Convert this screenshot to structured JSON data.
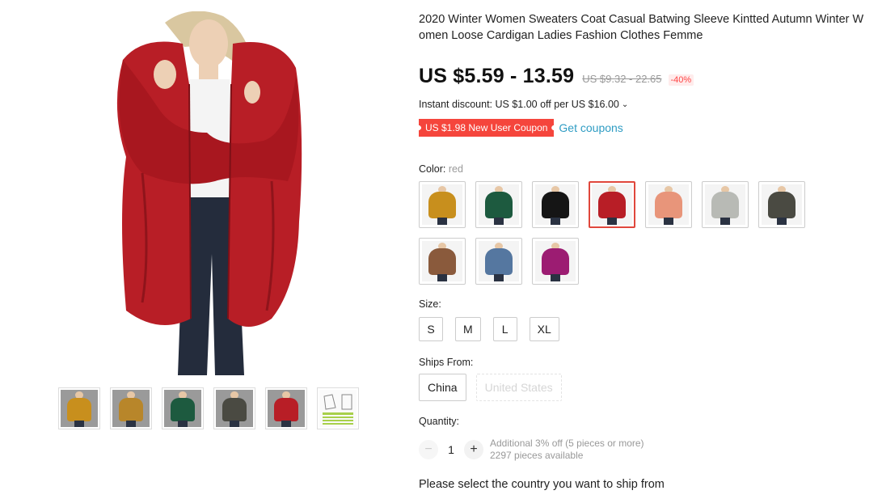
{
  "product": {
    "title": "2020 Winter Women Sweaters Coat Casual Batwing Sleeve Kintted Autumn Winter Women Loose Cardigan Ladies Fashion Clothes Femme",
    "main_image_color": "#b81e26"
  },
  "gallery": {
    "thumbnails": [
      {
        "color": "#c88f1d"
      },
      {
        "color": "#b8862a"
      },
      {
        "color": "#1d5a3f"
      },
      {
        "color": "#4a4a42"
      },
      {
        "color": "#b81e26"
      },
      {
        "color": "#e8e8e8"
      }
    ]
  },
  "pricing": {
    "price": "US $5.59 - 13.59",
    "original_price": "US $9.32 - 22.65",
    "discount": "-40%",
    "instant_discount": "Instant discount: US $1.00 off per US $16.00",
    "coupon_label": "US $1.98 New User Coupon",
    "coupon_link": "Get coupons"
  },
  "color": {
    "label": "Color:",
    "selected": "red",
    "options": [
      {
        "name": "yellow",
        "hex": "#c88f1d"
      },
      {
        "name": "green",
        "hex": "#1d5a3f"
      },
      {
        "name": "black",
        "hex": "#151515"
      },
      {
        "name": "red",
        "hex": "#b81e26"
      },
      {
        "name": "pink",
        "hex": "#e8957a"
      },
      {
        "name": "light-gray",
        "hex": "#b8bab5"
      },
      {
        "name": "dark-gray",
        "hex": "#4a4a42"
      },
      {
        "name": "brown",
        "hex": "#8a5a3c"
      },
      {
        "name": "blue",
        "hex": "#5577a0"
      },
      {
        "name": "purple",
        "hex": "#9c1c72"
      }
    ]
  },
  "size": {
    "label": "Size:",
    "options": [
      "S",
      "M",
      "L",
      "XL"
    ]
  },
  "ships_from": {
    "label": "Ships From:",
    "options": [
      "China",
      "United States"
    ]
  },
  "quantity": {
    "label": "Quantity:",
    "minus": "−",
    "plus": "+",
    "value": "1",
    "additional": "Additional 3% off (5 pieces or more)",
    "available": "2297 pieces available"
  },
  "ship_note": "Please select the country you want to ship from"
}
